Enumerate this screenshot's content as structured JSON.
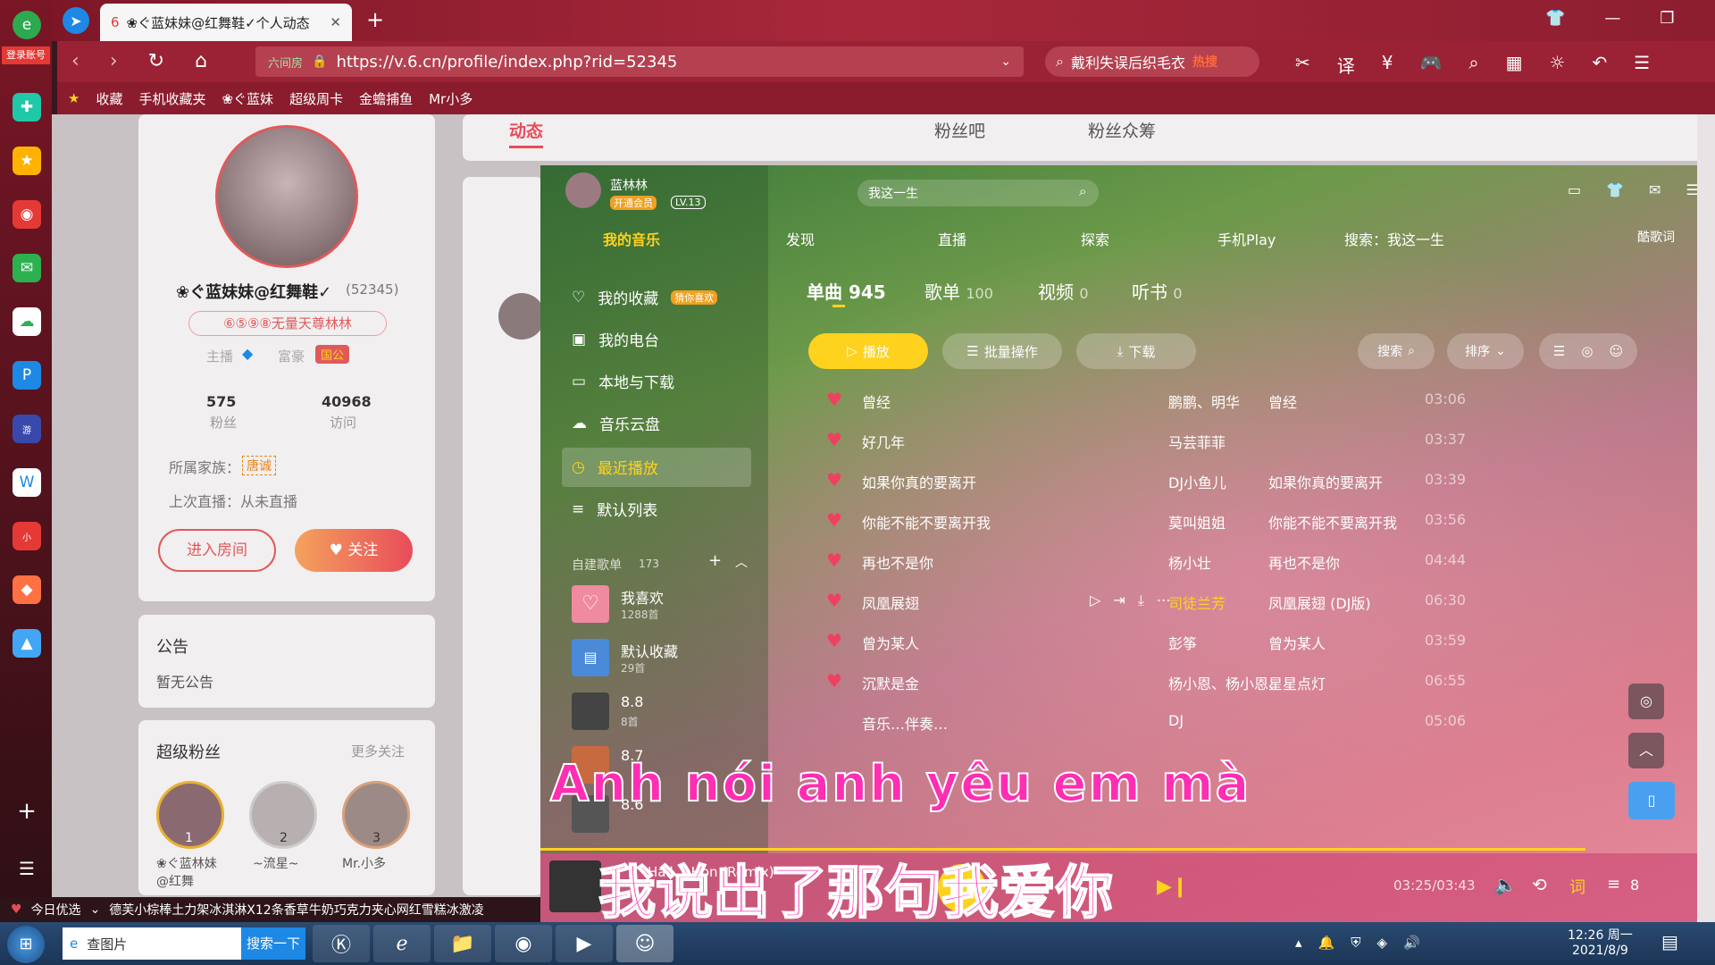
{
  "browser": {
    "tab_title": "❀ぐ蓝妹妹@红舞鞋✓个人动态",
    "new_tab": "+",
    "url": "https://v.6.cn/profile/index.php?rid=52345",
    "url_prefix": "六间房",
    "search_text": "戴利失误后织毛衣",
    "search_hot": "热搜",
    "login_label": "登录账号",
    "bookmarks": [
      "收藏",
      "手机收藏夹",
      "❀ぐ蓝妹",
      "超级周卡",
      "金蟾捕鱼",
      "Mr小多"
    ]
  },
  "profile": {
    "name": "❀ぐ蓝妹妹@红舞鞋✓",
    "rid": "(52345)",
    "badge": "⑥⑤⑨⑧无量天尊林林",
    "anchor_label": "主播",
    "rich_label": "富豪",
    "guo_label": "国公",
    "fans_count": "575",
    "fans_label": "粉丝",
    "visits_count": "40968",
    "visits_label": "访问",
    "family_label": "所属家族：",
    "family_value": "唐诚",
    "last_live": "上次直播：从未直播",
    "enter_room": "进入房间",
    "follow": "关注"
  },
  "notice": {
    "title": "公告",
    "body": "暂无公告"
  },
  "super_fans": {
    "title": "超级粉丝",
    "more": "更多关注",
    "fans": [
      {
        "rank": "1",
        "name": "❀ぐ蓝林妹@红舞"
      },
      {
        "rank": "2",
        "name": "~流星~"
      },
      {
        "rank": "3",
        "name": "Mr.小多"
      }
    ]
  },
  "page_tabs": [
    "动态",
    "粉丝吧",
    "粉丝众筹"
  ],
  "player": {
    "user": "蓝林林",
    "vip": "开通会员",
    "level": "LV.13",
    "search_placeholder": "我这一生",
    "nav": [
      "我的音乐",
      "发现",
      "直播",
      "探索",
      "手机Play",
      "搜索：我这一生",
      "酷歌词"
    ],
    "menu": [
      "我的收藏",
      "我的电台",
      "本地与下载",
      "音乐云盘",
      "最近播放",
      "默认列表"
    ],
    "fav_tag": "猜你喜欢",
    "playlists_title": "自建歌单",
    "playlists_count": "173",
    "playlists": [
      {
        "name": "我喜欢",
        "count": "1288首"
      },
      {
        "name": "默认收藏",
        "count": "29首"
      },
      {
        "name": "8.8",
        "count": "8首"
      },
      {
        "name": "8.7",
        "count": ""
      },
      {
        "name": "8.6",
        "count": ""
      }
    ],
    "tabs": [
      {
        "label": "单曲",
        "count": "945"
      },
      {
        "label": "歌单",
        "count": "100"
      },
      {
        "label": "视频",
        "count": "0"
      },
      {
        "label": "听书",
        "count": "0"
      }
    ],
    "play_btn": "播放",
    "batch_btn": "批量操作",
    "download_btn": "下载",
    "search_btn": "搜索",
    "sort_btn": "排序",
    "tracks": [
      {
        "title": "曾经",
        "artist": "鹏鹏、明华",
        "album": "曾经",
        "duration": "03:06"
      },
      {
        "title": "好几年",
        "artist": "马芸菲菲",
        "album": "",
        "duration": "03:37"
      },
      {
        "title": "如果你真的要离开",
        "artist": "DJ小鱼儿",
        "album": "如果你真的要离开",
        "duration": "03:39"
      },
      {
        "title": "你能不能不要离开我",
        "artist": "莫叫姐姐",
        "album": "你能不能不要离开我",
        "duration": "03:56"
      },
      {
        "title": "再也不是你",
        "artist": "杨小壮",
        "album": "再也不是你",
        "duration": "04:44"
      },
      {
        "title": "凤凰展翅",
        "artist": "司徒兰芳",
        "album": "凤凰展翅 (DJ版)",
        "duration": "06:30"
      },
      {
        "title": "曾为某人",
        "artist": "彭筝",
        "album": "曾为某人",
        "duration": "03:59"
      },
      {
        "title": "沉默是金",
        "artist": "杨小恩、杨小恩、",
        "album": "星星点灯",
        "duration": "06:55"
      },
      {
        "title": "音乐…伴奏…",
        "artist": "DJ",
        "album": "",
        "duration": "05:06"
      }
    ],
    "now_playing": "Hall… Hon (Remix)",
    "time": "03:25/03:43",
    "lyric_label": "词",
    "queue_count": "8",
    "lyric_vn": "Anh  nói  anh  yêu  em  mà",
    "lyric_cn": "我说出了那句我爱你"
  },
  "bottom_bar": {
    "today": "今日优选",
    "ad": "德芙小棕棒土力架冰淇淋X12条香草牛奶巧克力夹心网红雪糕冰激凌"
  },
  "taskbar": {
    "search_app": "查图片",
    "search_btn": "搜索一下",
    "time": "12:26 周一",
    "date": "2021/8/9"
  },
  "colors": {
    "accent": "#ffd21e",
    "heart": "#f04060",
    "brand": "#e84c5a"
  }
}
